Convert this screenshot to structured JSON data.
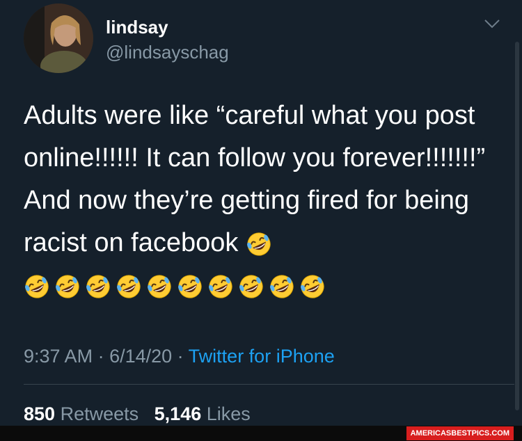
{
  "user": {
    "name": "lindsay",
    "handle": "@lindsayschag"
  },
  "tweet": {
    "text": "Adults were like “careful what you post online!!!!!! It can follow you forever!!!!!!!” And now they’re getting fired for being racist on facebook",
    "emoji": "rolling-on-the-floor-laughing",
    "emoji_count": 11
  },
  "meta": {
    "time": "9:37 AM",
    "sep1": " · ",
    "date": "6/14/20",
    "sep2": " · ",
    "source": "Twitter for iPhone"
  },
  "stats": {
    "retweets_count": "850",
    "retweets_label": "Retweets",
    "likes_count": "5,146",
    "likes_label": "Likes"
  },
  "watermark": "AMERICASBESTPICS.COM",
  "colors": {
    "background": "#15202b",
    "muted": "#8899a6",
    "accent": "#1da1f2"
  }
}
